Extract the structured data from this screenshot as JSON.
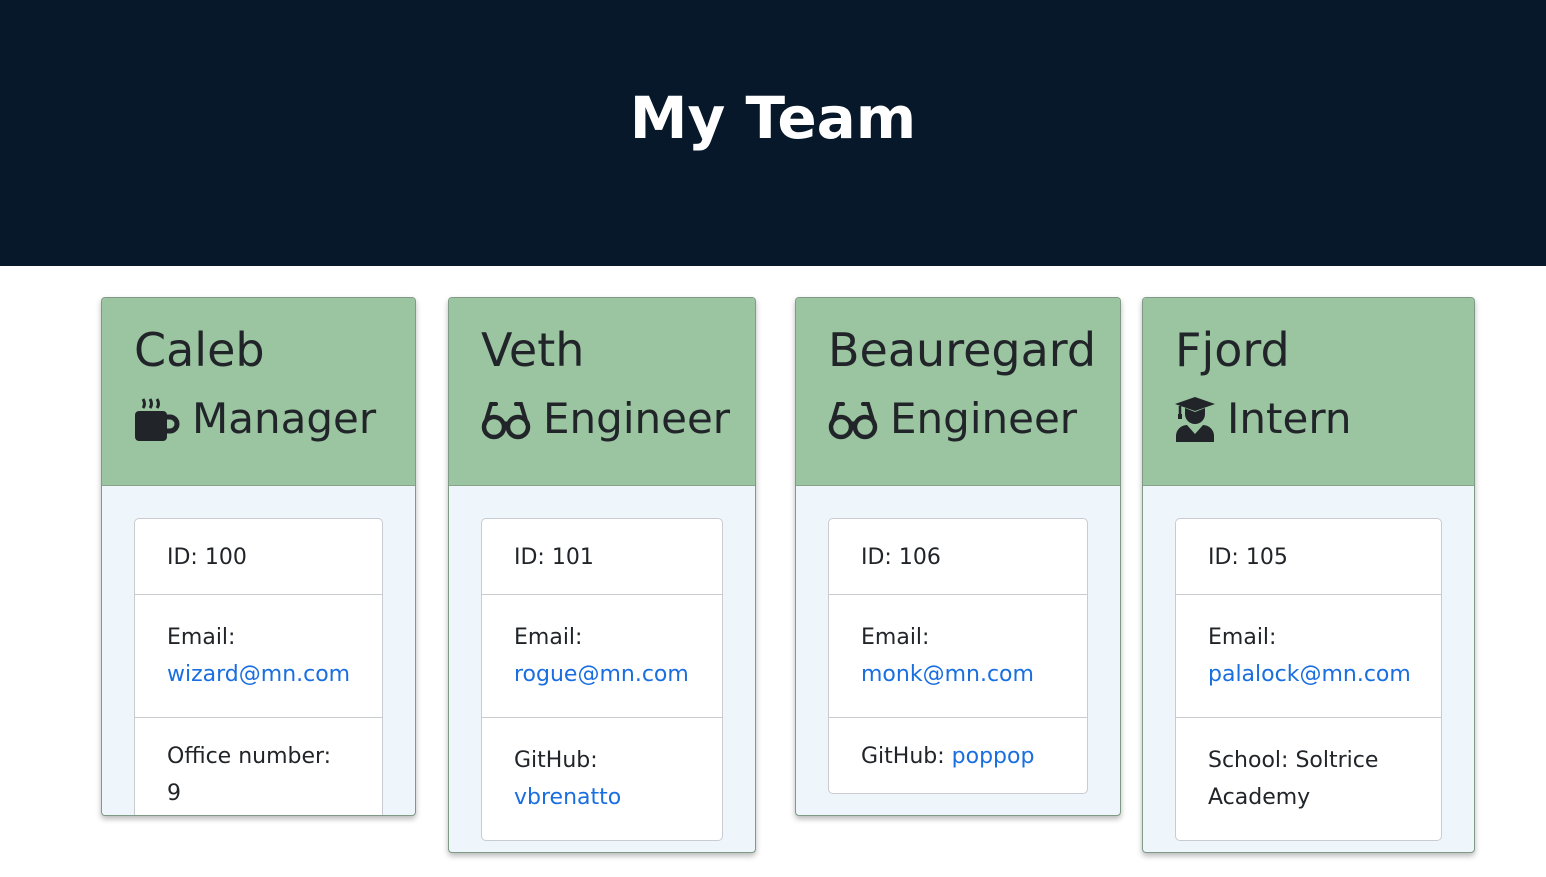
{
  "header": {
    "title": "My Team"
  },
  "members": [
    {
      "name": "Caleb",
      "role": "Manager",
      "icon": "mug-icon",
      "id_text": "ID: 100",
      "email_label": "Email:",
      "email": "wizard@mn.com",
      "extra_label": "Office number: 9",
      "extra_value": ""
    },
    {
      "name": "Veth",
      "role": "Engineer",
      "icon": "glasses-icon",
      "id_text": "ID: 101",
      "email_label": "Email:",
      "email": "rogue@mn.com",
      "extra_label": "GitHub:",
      "extra_value": "vbrenatto"
    },
    {
      "name": "Beauregard",
      "role": "Engineer",
      "icon": "glasses-icon",
      "id_text": "ID: 106",
      "email_label": "Email:",
      "email": "monk@mn.com",
      "extra_label": "GitHub:",
      "extra_value": "poppop"
    },
    {
      "name": "Fjord",
      "role": "Intern",
      "icon": "graduate-icon",
      "id_text": "ID: 105",
      "email_label": "Email:",
      "email": "palalock@mn.com",
      "extra_label": "School: Soltrice Academy",
      "extra_value": ""
    }
  ],
  "colors": {
    "header_bg": "#061829",
    "card_header": "#9bc4a0",
    "card_body": "#eef5fb",
    "link": "#1a6fe0"
  }
}
